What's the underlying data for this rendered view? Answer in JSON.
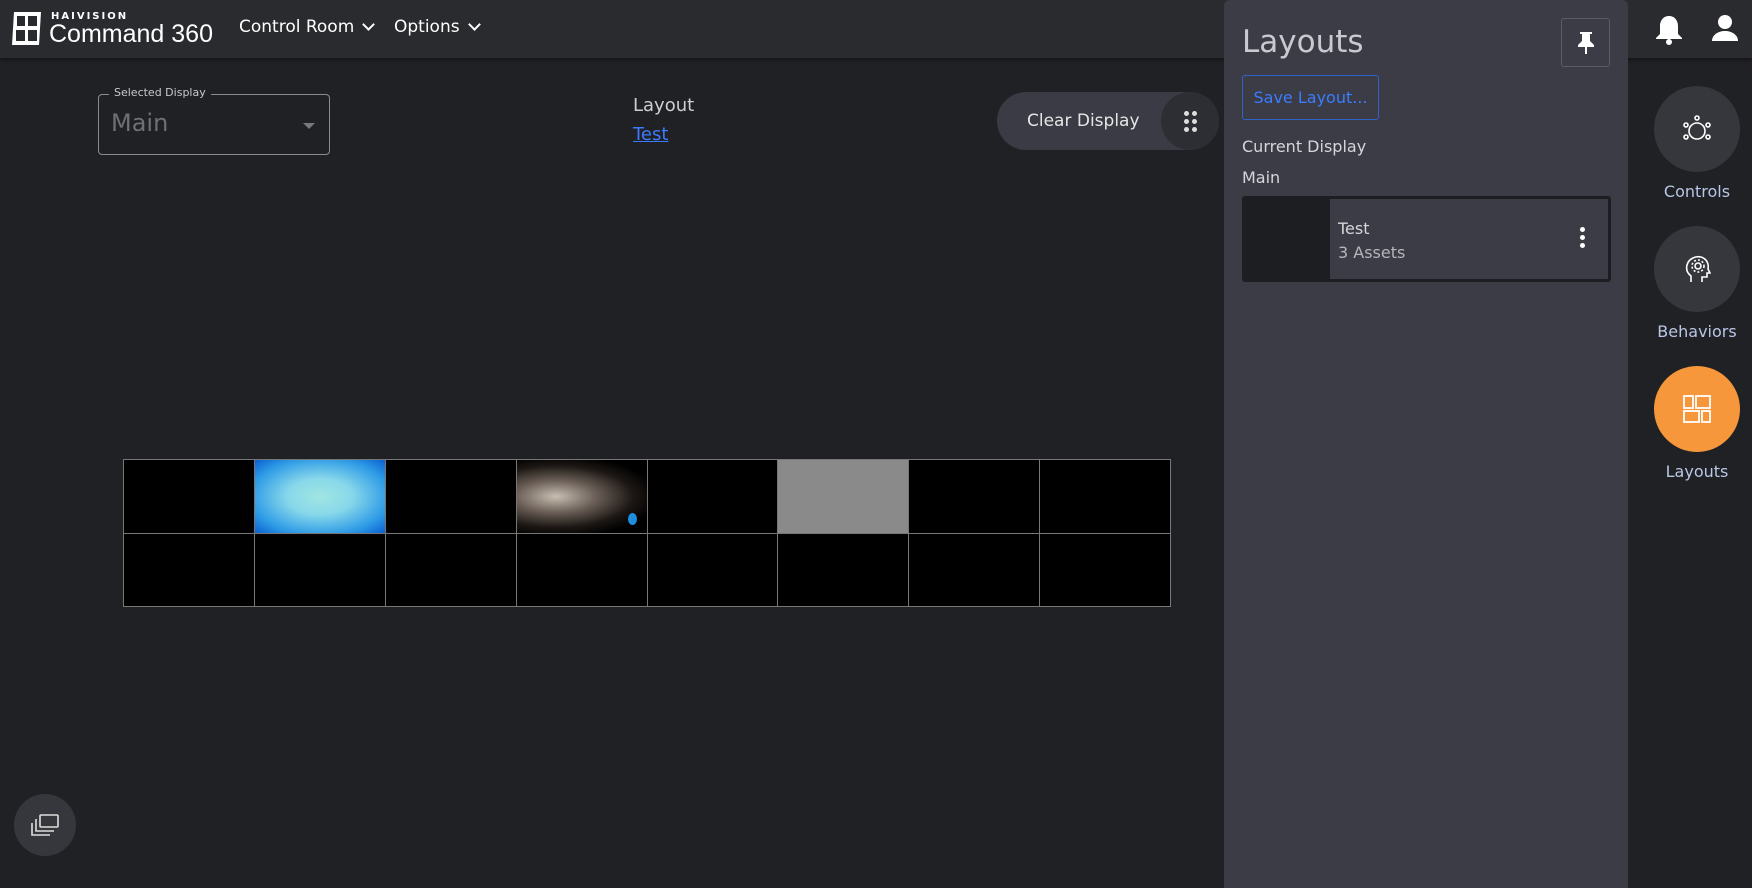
{
  "header": {
    "brand_small": "HAIVISION",
    "brand": "Command 360",
    "menus": [
      {
        "label": "Control Room"
      },
      {
        "label": "Options"
      }
    ]
  },
  "display_select": {
    "label": "Selected Display",
    "value": "Main"
  },
  "layout": {
    "label": "Layout",
    "name": "Test"
  },
  "clear_display": "Clear Display",
  "wall": {
    "columns": 8,
    "rows": 2,
    "cells": [
      "empty",
      "blue-source",
      "empty",
      "video",
      "empty",
      "grey",
      "empty",
      "empty",
      "empty",
      "empty",
      "empty",
      "empty",
      "empty",
      "empty",
      "empty",
      "empty"
    ]
  },
  "panel": {
    "title": "Layouts",
    "save_label": "Save Layout...",
    "current_display_label": "Current Display",
    "current_display": "Main",
    "layouts": [
      {
        "name": "Test",
        "assets": "3 Assets"
      }
    ]
  },
  "rail": [
    {
      "label": "Controls",
      "icon": "controls-icon"
    },
    {
      "label": "Behaviors",
      "icon": "behaviors-icon"
    },
    {
      "label": "Layouts",
      "icon": "layouts-icon",
      "active": true
    }
  ],
  "colors": {
    "accent": "#f7973b",
    "link": "#3c7bff"
  }
}
